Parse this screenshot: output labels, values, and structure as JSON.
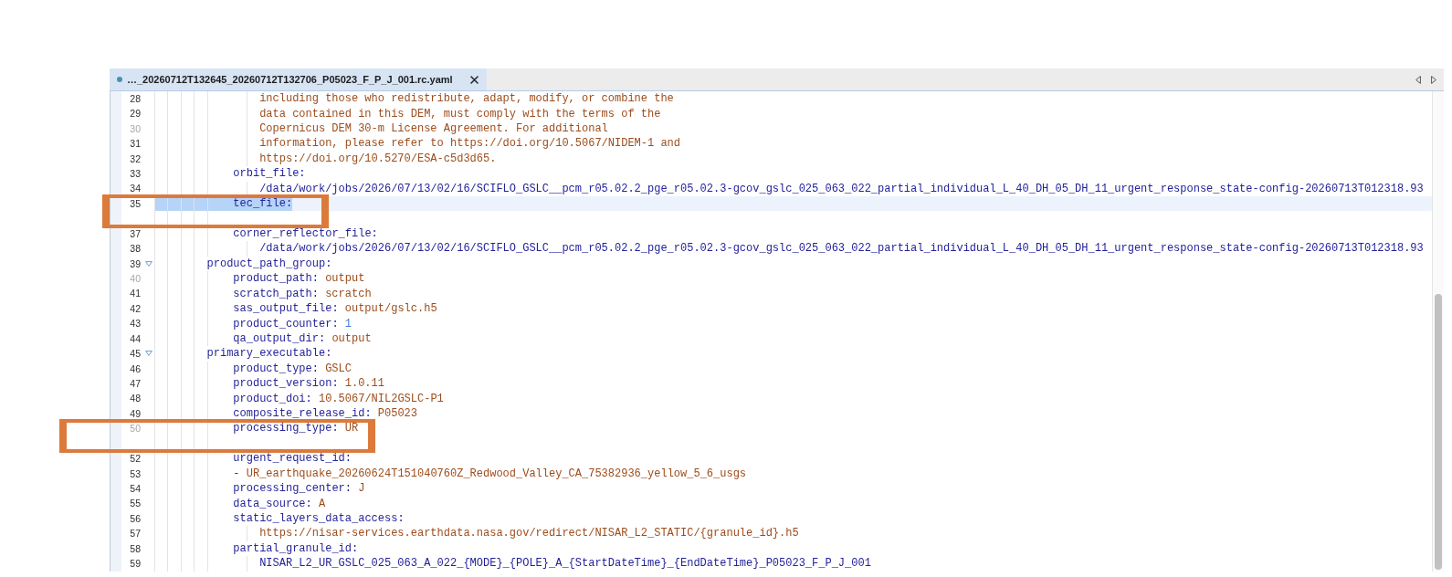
{
  "editor_tab": {
    "title": "…_20260712T132645_20260712T132706_P05023_F_P_J_001.rc.yaml",
    "selected": true
  },
  "lines": [
    {
      "kind": "group",
      "children": [
        {
          "kind": "group",
          "children": [
            {
              "kind": "line",
              "number": "28",
              "dimmed": false,
              "selected": false,
              "annotated": false,
              "text": {
                "kind": "string",
                "text": "including those who redistribute, adapt, modify, or combine the"
              }
            },
            {
              "kind": "line",
              "number": "29",
              "dimmed": false,
              "selected": false,
              "annotated": false,
              "text": {
                "kind": "string",
                "text": "data contained in this DEM, must comply with the terms of the"
              }
            },
            {
              "kind": "line",
              "number": "30",
              "dimmed": true,
              "selected": false,
              "annotated": false,
              "text": {
                "kind": "string",
                "text": "Copernicus DEM 30-m License Agreement. For additional"
              }
            },
            {
              "kind": "line",
              "number": "31",
              "dimmed": false,
              "selected": false,
              "annotated": false,
              "text": {
                "kind": "string",
                "text": "information, please refer to https://doi.org/10.5067/NIDEM-1 and"
              }
            },
            {
              "kind": "line",
              "number": "32",
              "dimmed": false,
              "selected": false,
              "annotated": false,
              "text": {
                "kind": "string",
                "text": "https://doi.org/10.5270/ESA-c5d3d65."
              }
            }
          ]
        },
        {
          "kind": "line",
          "number": "33",
          "dimmed": false,
          "selected": false,
          "annotated": false,
          "key": "orbit_file:",
          "children": [
            {
              "kind": "line",
              "number": "34",
              "dimmed": false,
              "selected": false,
              "annotated": false,
              "text": {
                "kind": "plain",
                "text": "/data/work/jobs/2026/07/13/02/16/SCIFLO_GSLC__pcm_r05.02.2_pge_r05.02.3-gcov_gslc_025_063_022_partial_individual_L_40_DH_05_DH_11_urgent_response_state-config-20260713T012318.93"
              }
            }
          ]
        },
        {
          "kind": "line",
          "number": "35",
          "dimmed": false,
          "selected": true,
          "annotated": true,
          "key": "tec_file:"
        },
        {
          "kind": "covered"
        },
        {
          "kind": "line",
          "number": "37",
          "dimmed": false,
          "selected": false,
          "annotated": false,
          "key": "corner_reflector_file:",
          "children": [
            {
              "kind": "line",
              "number": "38",
              "dimmed": false,
              "selected": false,
              "annotated": false,
              "text": {
                "kind": "plain",
                "text": "/data/work/jobs/2026/07/13/02/16/SCIFLO_GSLC__pcm_r05.02.2_pge_r05.02.3-gcov_gslc_025_063_022_partial_individual_L_40_DH_05_DH_11_urgent_response_state-config-20260713T012318.93"
              }
            }
          ]
        }
      ]
    },
    {
      "kind": "line",
      "number": "39",
      "dimmed": false,
      "selected": false,
      "annotated": false,
      "expanded": true,
      "key": "product_path_group:",
      "children": [
        {
          "kind": "line",
          "number": "40",
          "dimmed": true,
          "selected": false,
          "annotated": false,
          "key": "product_path:",
          "value": {
            "kind": "string",
            "text": "output"
          }
        },
        {
          "kind": "line",
          "number": "41",
          "dimmed": false,
          "selected": false,
          "annotated": false,
          "key": "scratch_path:",
          "value": {
            "kind": "string",
            "text": "scratch"
          }
        },
        {
          "kind": "line",
          "number": "42",
          "dimmed": false,
          "selected": false,
          "annotated": false,
          "key": "sas_output_file:",
          "value": {
            "kind": "string",
            "text": "output/gslc.h5"
          }
        },
        {
          "kind": "line",
          "number": "43",
          "dimmed": false,
          "selected": false,
          "annotated": false,
          "key": "product_counter:",
          "value": {
            "kind": "number",
            "text": "1"
          }
        },
        {
          "kind": "line",
          "number": "44",
          "dimmed": false,
          "selected": false,
          "annotated": false,
          "key": "qa_output_dir:",
          "value": {
            "kind": "string",
            "text": "output"
          }
        }
      ]
    },
    {
      "kind": "line",
      "number": "45",
      "dimmed": false,
      "selected": false,
      "annotated": false,
      "expanded": true,
      "key": "primary_executable:",
      "children": [
        {
          "kind": "line",
          "number": "46",
          "dimmed": false,
          "selected": false,
          "annotated": false,
          "key": "product_type:",
          "value": {
            "kind": "string",
            "text": "GSLC"
          }
        },
        {
          "kind": "line",
          "number": "47",
          "dimmed": false,
          "selected": false,
          "annotated": false,
          "key": "product_version:",
          "value": {
            "kind": "string",
            "text": "1.0.11"
          }
        },
        {
          "kind": "line",
          "number": "48",
          "dimmed": false,
          "selected": false,
          "annotated": false,
          "key": "product_doi:",
          "value": {
            "kind": "string",
            "text": "10.5067/NIL2GSLC-P1"
          }
        },
        {
          "kind": "line",
          "number": "49",
          "dimmed": false,
          "selected": false,
          "annotated": false,
          "key": "composite_release_id:",
          "value": {
            "kind": "string",
            "text": "P05023"
          }
        },
        {
          "kind": "line",
          "number": "50",
          "dimmed": true,
          "selected": false,
          "annotated": true,
          "key": "processing_type:",
          "value": {
            "kind": "string",
            "text": "UR"
          }
        },
        {
          "kind": "covered"
        },
        {
          "kind": "line",
          "number": "52",
          "dimmed": false,
          "selected": false,
          "annotated": false,
          "key": "urgent_request_id:"
        },
        {
          "kind": "line",
          "number": "53",
          "dimmed": false,
          "selected": false,
          "annotated": false,
          "dash": "-",
          "text": {
            "kind": "string",
            "text": "UR_earthquake_20260624T151040760Z_Redwood_Valley_CA_75382936_yellow_5_6_usgs"
          }
        },
        {
          "kind": "line",
          "number": "54",
          "dimmed": false,
          "selected": false,
          "annotated": false,
          "key": "processing_center:",
          "value": {
            "kind": "string",
            "text": "J"
          }
        },
        {
          "kind": "line",
          "number": "55",
          "dimmed": false,
          "selected": false,
          "annotated": false,
          "key": "data_source:",
          "value": {
            "kind": "string",
            "text": "A"
          }
        },
        {
          "kind": "line",
          "number": "56",
          "dimmed": false,
          "selected": false,
          "annotated": false,
          "key": "static_layers_data_access:",
          "children": [
            {
              "kind": "line",
              "number": "57",
              "dimmed": false,
              "selected": false,
              "annotated": false,
              "text": {
                "kind": "string",
                "text": "https://nisar-services.earthdata.nasa.gov/redirect/NISAR_L2_STATIC/{granule_id}.h5"
              }
            }
          ]
        },
        {
          "kind": "line",
          "number": "58",
          "dimmed": false,
          "selected": false,
          "annotated": false,
          "key": "partial_granule_id:",
          "children": [
            {
              "kind": "line",
              "number": "59",
              "dimmed": false,
              "selected": false,
              "annotated": false,
              "text": {
                "kind": "plain",
                "text": "NISAR_L2_UR_GSLC_025_063_A_022_{MODE}_{POLE}_A_{StartDateTime}_{EndDateTime}_P05023_F_P_J_001"
              }
            }
          ]
        }
      ]
    }
  ]
}
